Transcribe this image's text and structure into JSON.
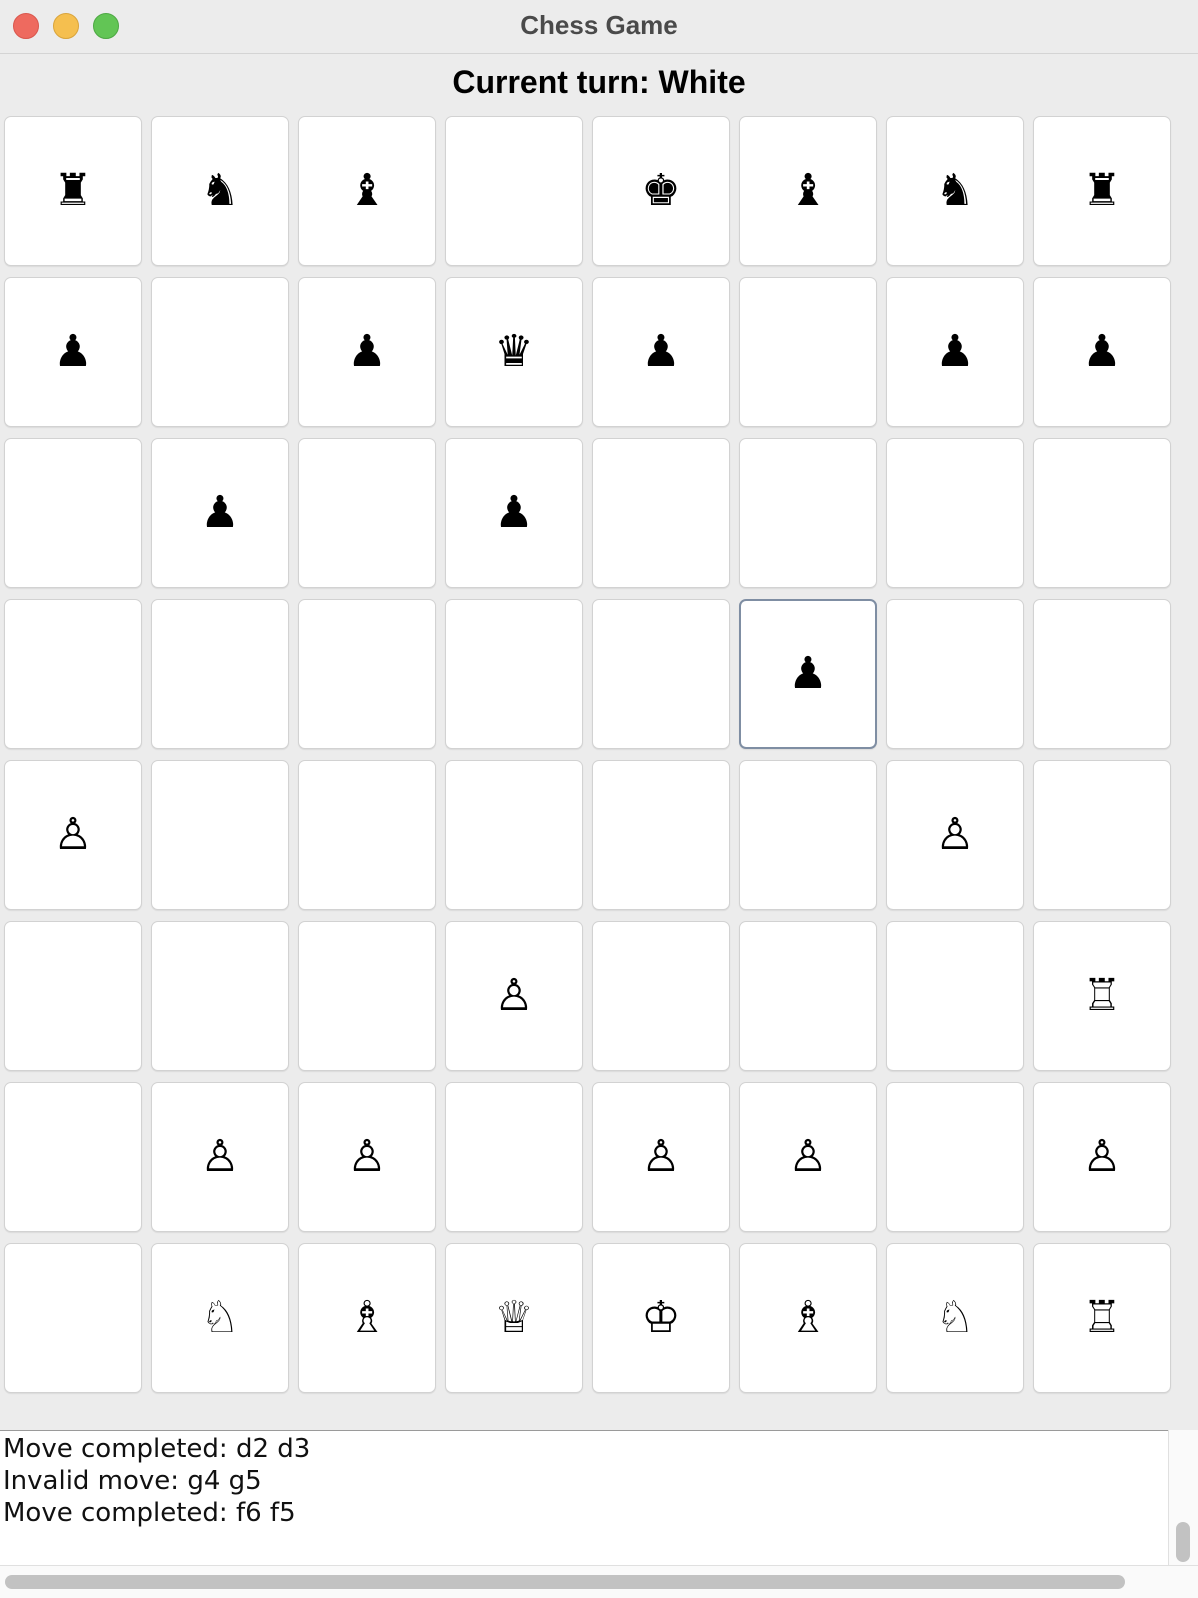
{
  "window": {
    "title": "Chess Game"
  },
  "status": {
    "turn_text": "Current turn: White"
  },
  "board": {
    "rows": [
      [
        "♜",
        "♞",
        "♝",
        "",
        "♚",
        "♝",
        "♞",
        "♜"
      ],
      [
        "♟",
        "",
        "♟",
        "♛",
        "♟",
        "",
        "♟",
        "♟"
      ],
      [
        "",
        "♟",
        "",
        "♟",
        "",
        "",
        "",
        ""
      ],
      [
        "",
        "",
        "",
        "",
        "",
        "♟",
        "",
        ""
      ],
      [
        "♙",
        "",
        "",
        "",
        "",
        "",
        "♙",
        ""
      ],
      [
        "",
        "",
        "",
        "♙",
        "",
        "",
        "",
        "♖"
      ],
      [
        "",
        "♙",
        "♙",
        "",
        "♙",
        "♙",
        "",
        "♙"
      ],
      [
        "",
        "♘",
        "♗",
        "♕",
        "♔",
        "♗",
        "♘",
        "♖"
      ]
    ],
    "selected": {
      "row": 3,
      "col": 5
    }
  },
  "log": {
    "lines": [
      "Move completed: d2 d3",
      "Invalid move: g4 g5",
      "Move completed: f6 f5"
    ]
  }
}
